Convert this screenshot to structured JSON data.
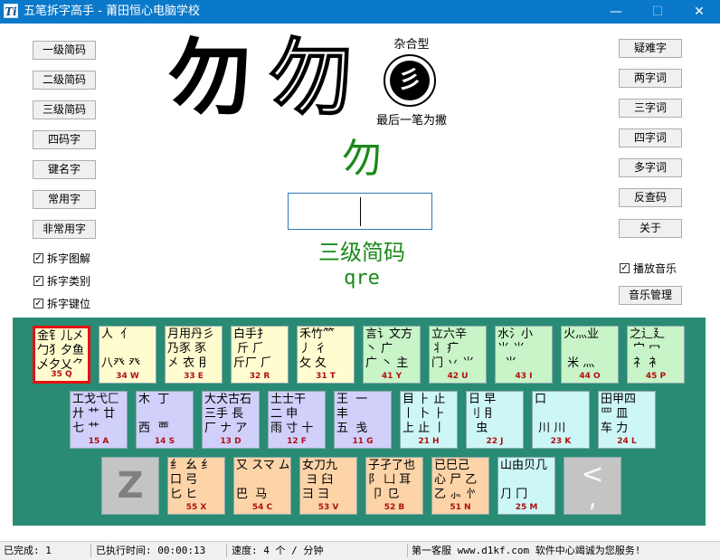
{
  "window": {
    "icon_text": "Ti",
    "title": "五笔拆字高手 - 莆田恒心电脑学校",
    "min_glyph": "—",
    "max_glyph": "☐",
    "close_glyph": "✕"
  },
  "left_buttons": [
    "一级简码",
    "二级简码",
    "三级简码",
    "四码字",
    "键名字",
    "常用字",
    "非常用字"
  ],
  "right_buttons": [
    "疑难字",
    "两字词",
    "三字词",
    "四字词",
    "多字词",
    "反查码",
    "关于"
  ],
  "checkboxes": [
    {
      "label": "拆字图解",
      "checked": true,
      "mark": "✓"
    },
    {
      "label": "拆字类别",
      "checked": true,
      "mark": "✓"
    },
    {
      "label": "拆字键位",
      "checked": true,
      "mark": "✓"
    }
  ],
  "music": {
    "play_label": "播放音乐",
    "checked": true,
    "mark": "✓",
    "manage_label": "音乐管理"
  },
  "display": {
    "char_solid": "勿",
    "char_outline": "勿",
    "type_label": "杂合型",
    "type_icon": "彡",
    "last_stroke": "最后一笔为撇",
    "green_char": "勿",
    "input_value": "",
    "code_level": "三级简码",
    "code_value": "qre"
  },
  "keys": {
    "q": {
      "radicals": "金钅儿㐅\n勹犭夕鱼\n乄夕乂⺈",
      "label": "35 Q"
    },
    "w": {
      "radicals": "人  亻\n\n八癶 癶",
      "label": "34 W"
    },
    "e": {
      "radicals": "月用丹彡\n乃豕 豕\n㐅 衣 ⺝",
      "label": "33 E"
    },
    "r": {
      "radicals": "白手扌\n 斤 ⺁\n斤厂 ⺁",
      "label": "32 R"
    },
    "t": {
      "radicals": "禾竹⺮\n丿 彳\n攵 夂",
      "label": "31 T"
    },
    "y": {
      "radicals": "言讠文方\n丶 广\n广 丶 主",
      "label": "41 Y"
    },
    "u": {
      "radicals": "立六辛\n丬 疒\n门 丷 ⺌",
      "label": "42 U"
    },
    "i": {
      "radicals": "水氵小\n⺌ ⺌\n  ⺌",
      "label": "43 I"
    },
    "o": {
      "radicals": "火灬业\n\n 米 灬",
      "label": "44 O"
    },
    "p": {
      "radicals": "之辶廴\n 宀 冖\n 礻 衤",
      "label": "45 P"
    },
    "a": {
      "radicals": "工戈弋匚\n廾 艹 廿\n七 艹",
      "label": "15 A"
    },
    "s": {
      "radicals": "木  丁\n\n西  覀",
      "label": "14 S"
    },
    "d": {
      "radicals": "大犬古石\n三手 長\n厂 ナ ア",
      "label": "13 D"
    },
    "f": {
      "radicals": "土士干\n二 申\n雨 寸 十",
      "label": "12 F"
    },
    "g": {
      "radicals": "王  一\n丰\n五  戋",
      "label": "11 G"
    },
    "h": {
      "radicals": "目 ⺊ 止\n丨 卜 ⺊\n上 止 丨",
      "label": "21 H"
    },
    "j": {
      "radicals": "日 早\n刂 ⺝\n  虫",
      "label": "22 J"
    },
    "k": {
      "radicals": "口\n\n 川 川",
      "label": "23 K"
    },
    "l": {
      "radicals": "田甲四\n罒 皿\n车 力",
      "label": "24 L"
    },
    "z": {
      "radicals": "Z",
      "label": ""
    },
    "x": {
      "radicals": "纟 幺 纟\n口 弓\n匕 ヒ",
      "label": "55 X"
    },
    "c": {
      "radicals": "又 スマ ム\n\n巴  马",
      "label": "54 C"
    },
    "v": {
      "radicals": "女刀九\n ヨ 臼\n彐 ⺕",
      "label": "53 V"
    },
    "b": {
      "radicals": "子孑了也\n阝 凵 耳\n 卩 ⺋",
      "label": "52 B"
    },
    "n": {
      "radicals": "已巳己\n心 尸 乙\n乙 ⺗ 㣺",
      "label": "51 N"
    },
    "m": {
      "radicals": "山由贝几\n\n⺆ 冂",
      "label": "25 M"
    },
    "comma": {
      "radicals": "<\n,",
      "label": ""
    }
  },
  "status": {
    "completed": "已完成: 1",
    "elapsed": "已执行时间: 00:00:13",
    "speed": "速度:  4 个 / 分钟",
    "site": "第一客服 www.d1kf.com 软件中心竭诚为您服务!"
  }
}
